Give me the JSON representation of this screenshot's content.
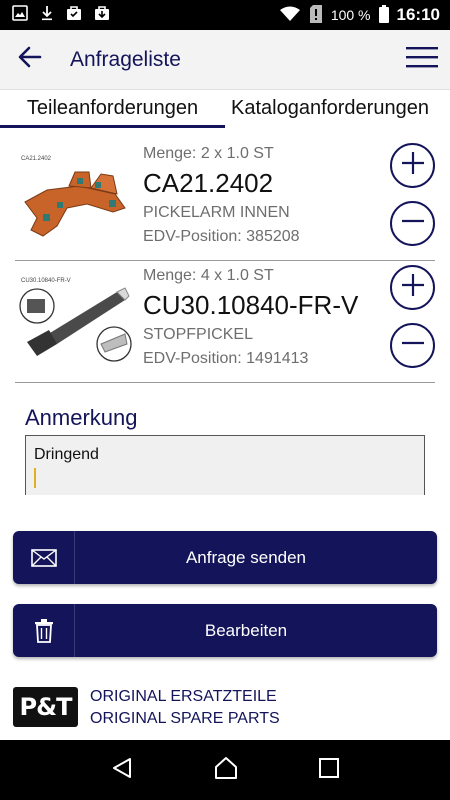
{
  "status_bar": {
    "battery": "100 %",
    "time": "16:10",
    "icons": [
      "image-icon",
      "download-icon",
      "bag-icon",
      "bag-icon",
      "wifi-icon",
      "sim-alert-icon",
      "battery-icon"
    ]
  },
  "app_bar": {
    "title": "Anfrageliste",
    "back_icon": "arrow-left-icon",
    "menu_icon": "hamburger-menu-icon"
  },
  "tabs": [
    {
      "label": "Teileanforderungen",
      "active": true
    },
    {
      "label": "Kataloganforderungen",
      "active": false
    }
  ],
  "items": [
    {
      "thumb_label": "CA21.2402",
      "quantity": "Menge: 2 x 1.0 ST",
      "code": "CA21.2402",
      "description": "PICKELARM INNEN",
      "edv": "EDV-Position: 385208"
    },
    {
      "thumb_label": "CU30.10840-FR-V",
      "quantity": "Menge: 4 x 1.0 ST",
      "code": "CU30.10840-FR-V",
      "description": "STOPFPICKEL",
      "edv": "EDV-Position: 1491413"
    }
  ],
  "note": {
    "label": "Anmerkung",
    "value": "Dringend"
  },
  "buttons": {
    "send": "Anfrage senden",
    "edit": "Bearbeiten"
  },
  "footer": {
    "logo_text": "P&T",
    "line1": "ORIGINAL ERSATZTEILE",
    "line2": "ORIGINAL SPARE PARTS"
  },
  "colors": {
    "primary": "#14145a",
    "accent_caret": "#e0b020",
    "part_orange": "#c8642a"
  }
}
